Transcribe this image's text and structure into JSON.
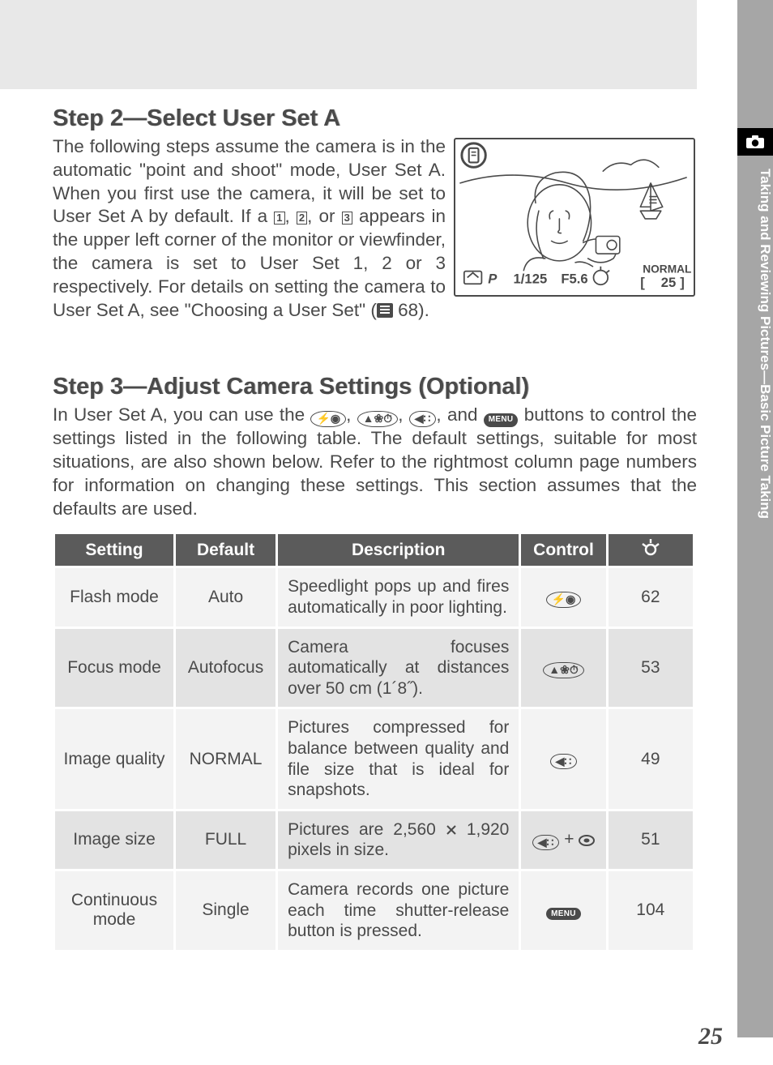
{
  "steps": {
    "step2": {
      "title": "Step 2—Select User Set A",
      "body_parts": {
        "a": "The following steps assume the camera is in the automatic \"point and shoot\" mode, User Set A. When you first use the camera, it will be set to User Set A by default. If a ",
        "b": ", ",
        "c": ", or ",
        "d": " appears in the upper left corner of the monitor or viewfinder, the camera is set to User Set 1, 2 or 3 respectively. For details on setting the camera to User Set A, see \"Choosing a User Set\" (",
        "e": " 68)."
      },
      "set_icons": {
        "i1": "1",
        "i2": "2",
        "i3": "3"
      }
    },
    "step3": {
      "title": "Step 3—Adjust Camera Settings (Optional)",
      "body_parts": {
        "a": "In User Set A, you can use the ",
        "b": ", ",
        "c": ", ",
        "d": ", and ",
        "e": " buttons to control the settings listed in the following table.  The default settings, suitable for most situations, are also shown below. Refer to the rightmost column page numbers for information on changing these settings. This section assumes that the defaults are used."
      }
    }
  },
  "lcd": {
    "shutter": "1/125",
    "aperture": "F5.6",
    "quality": "NORMAL",
    "left_br": "[",
    "count": "25",
    "right_br": "]"
  },
  "table": {
    "headers": {
      "setting": "Setting",
      "default": "Default",
      "description": "Description",
      "control": "Control"
    },
    "rows": [
      {
        "setting": "Flash mode",
        "default": "Auto",
        "desc": "Speedlight pops up and fires automatically in poor lighting.",
        "page": "62",
        "control": "flash"
      },
      {
        "setting": "Focus mode",
        "default": "Autofocus",
        "desc": "Camera focuses automatically at distances over 50 cm (1´8˝).",
        "page": "53",
        "control": "focus"
      },
      {
        "setting": "Image quality",
        "default": "NORMAL",
        "desc": "Pictures compressed for balance between quality and file size that is ideal for snapshots.",
        "page": "49",
        "control": "qual"
      },
      {
        "setting": "Image size",
        "default": "FULL",
        "desc_a": "Pictures are 2,560 ",
        "desc_b": " 1,920 pixels in size.",
        "page": "51",
        "control": "qual+sel"
      },
      {
        "setting": "Continuous mode",
        "default": "Single",
        "desc": "Camera records one picture each time shutter-release button is pressed.",
        "page": "104",
        "control": "menu"
      }
    ]
  },
  "sidebar": {
    "text": "Taking and Reviewing Pictures—Basic Picture Taking"
  },
  "buttons": {
    "menu": "MENU",
    "plus": " + "
  },
  "page_number": "25"
}
